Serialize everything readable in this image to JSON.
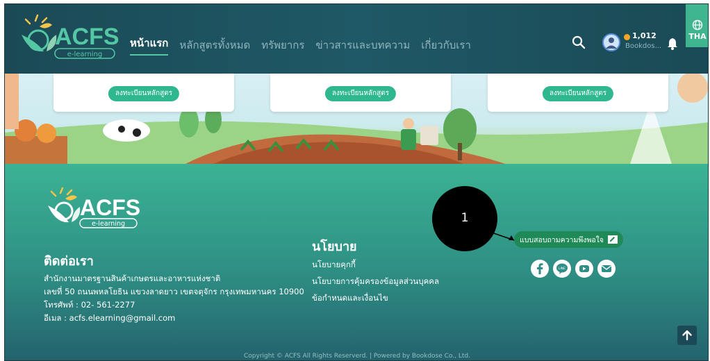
{
  "header": {
    "logo_text": "ACFS",
    "logo_subtext": "e-learning",
    "nav": [
      {
        "label": "หน้าแรก",
        "active": true
      },
      {
        "label": "หลักสูตรทั้งหมด",
        "active": false
      },
      {
        "label": "ทรัพยากร",
        "active": false
      },
      {
        "label": "ข่าวสารและบทความ",
        "active": false
      },
      {
        "label": "เกี่ยวกับเรา",
        "active": false
      }
    ],
    "points": "1,012",
    "username": "Bookdos...",
    "language": "THA",
    "icons": {
      "search": "search-icon",
      "bell": "bell-icon",
      "globe": "globe-icon",
      "coin": "coin-icon",
      "avatar": "avatar-icon"
    }
  },
  "banner": {
    "cards": [
      {
        "button_label": "ลงทะเบียนหลักสูตร"
      },
      {
        "button_label": "ลงทะเบียนหลักสูตร"
      },
      {
        "button_label": "ลงทะเบียนหลักสูตร"
      }
    ]
  },
  "footer": {
    "logo_text": "ACFS",
    "logo_subtext": "e-learning",
    "contact_title": "ติดต่อเรา",
    "contact_lines": [
      "สำนักงานมาตรฐานสินค้าเกษตรและอาหารแห่งชาติ",
      "เลขที่ 50 ถนนพหลโยธิน แขวงลาดยาว เขตจตุจักร กรุงเทพมหานคร 10900",
      "โทรศัพท์ : 02- 561-2277",
      "อีเมล : acfs.elearning@gmail.com"
    ],
    "policy_title": "นโยบาย",
    "policy_links": [
      "นโยบายคุกกี้",
      "นโยบายการคุ้มครองข้อมูลส่วนบุคคล",
      "ข้อกำหนดและเงื่อนไข"
    ],
    "survey_label": "แบบสอบถามความพึงพอใจ",
    "social": [
      "facebook-icon",
      "line-icon",
      "youtube-icon",
      "mail-icon"
    ],
    "copyright": "Copyright © ACFS All Rights Reserverd. | Powered by Bookdose Co., Ltd."
  },
  "annotation": {
    "number": "1"
  },
  "colors": {
    "header": "#1f5866",
    "accent": "#3fb58f",
    "footer_top": "#3bb394",
    "footer_bottom": "#24626d",
    "survey": "#1f8a57"
  }
}
